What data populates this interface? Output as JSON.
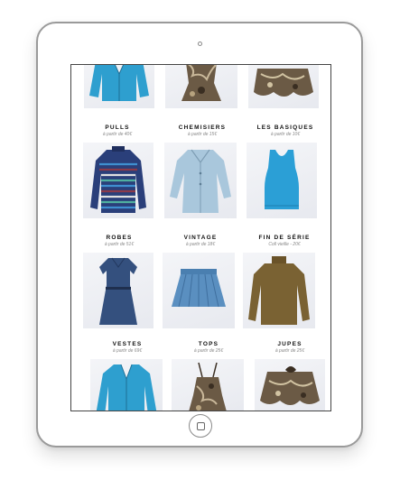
{
  "catalog": {
    "rows": [
      {
        "items": [
          {
            "title": "",
            "price": "",
            "garment": "blue-jacket"
          },
          {
            "title": "",
            "price": "",
            "garment": "print-top"
          },
          {
            "title": "",
            "price": "",
            "garment": "print-skirt"
          }
        ]
      },
      {
        "items": [
          {
            "title": "PULLS",
            "price": "à partir de 40€",
            "garment": "striped-sweater"
          },
          {
            "title": "CHEMISIERS",
            "price": "à partir de 15€",
            "garment": "light-blue-shirt"
          },
          {
            "title": "LES BASIQUES",
            "price": "à partir de 10€",
            "garment": "turquoise-tank"
          }
        ]
      },
      {
        "items": [
          {
            "title": "ROBES",
            "price": "à partir de 51€",
            "garment": "denim-dress"
          },
          {
            "title": "VINTAGE",
            "price": "à partir de 18€",
            "garment": "denim-skirt"
          },
          {
            "title": "FIN DE SÉRIE",
            "price": "Coll vieille - 20€",
            "garment": "brown-turtleneck"
          }
        ]
      },
      {
        "items": [
          {
            "title": "VESTES",
            "price": "à partir de 69€",
            "garment": "blue-jacket"
          },
          {
            "title": "TOPS",
            "price": "à partir de 25€",
            "garment": "print-top"
          },
          {
            "title": "JUPES",
            "price": "à partir de 25€",
            "garment": "print-skirt"
          }
        ]
      }
    ]
  },
  "colors": {
    "jacket": "#2e9fcf",
    "sweater_stripes": [
      "#2a3f7a",
      "#3f8fd0",
      "#8b3a4a",
      "#e0e0e0",
      "#4fb0a0"
    ],
    "shirt": "#a9c7dc",
    "tank": "#2b9fd6",
    "dress": "#34507e",
    "denim_skirt": "#5a8fc0",
    "turtleneck": "#7a6233",
    "print": "#6b5a45"
  }
}
